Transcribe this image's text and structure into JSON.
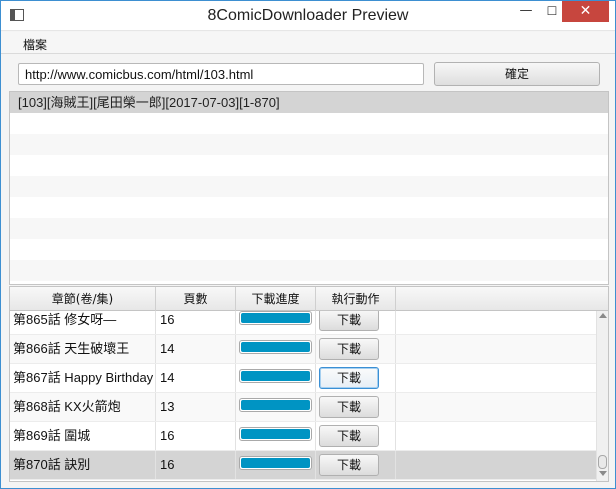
{
  "window": {
    "title": "8ComicDownloader Preview",
    "minimize_glyph": "—",
    "maximize_glyph": "☐",
    "close_glyph": "✕"
  },
  "menu": {
    "items": [
      {
        "label": "檔案"
      }
    ]
  },
  "url_bar": {
    "value": "http://www.comicbus.com/html/103.html",
    "confirm_label": "確定"
  },
  "comic_list": {
    "items": [
      {
        "label": "[103][海賊王][尾田榮一郎][2017-07-03][1-870]",
        "selected": true
      }
    ],
    "empty_rows": 8
  },
  "chapter_table": {
    "columns": [
      "章節(卷/集)",
      "頁數",
      "下載進度",
      "執行動作"
    ],
    "rows": [
      {
        "chapter": "第865話 修女呀—",
        "pages": "16",
        "progress": 1.0,
        "action": "下載"
      },
      {
        "chapter": "第866話 天生破壞王",
        "pages": "14",
        "progress": 1.0,
        "action": "下載"
      },
      {
        "chapter": "第867話 Happy Birthday",
        "pages": "14",
        "progress": 1.0,
        "action": "下載",
        "focused": true
      },
      {
        "chapter": "第868話 KX火箭炮",
        "pages": "13",
        "progress": 1.0,
        "action": "下載"
      },
      {
        "chapter": "第869話 圍城",
        "pages": "16",
        "progress": 1.0,
        "action": "下載"
      },
      {
        "chapter": "第870話 訣別",
        "pages": "16",
        "progress": 1.0,
        "action": "下載",
        "selected": true
      }
    ]
  },
  "colors": {
    "accent": "#0094c3",
    "close_button": "#c7463e",
    "selection": "#d4d4d4"
  }
}
